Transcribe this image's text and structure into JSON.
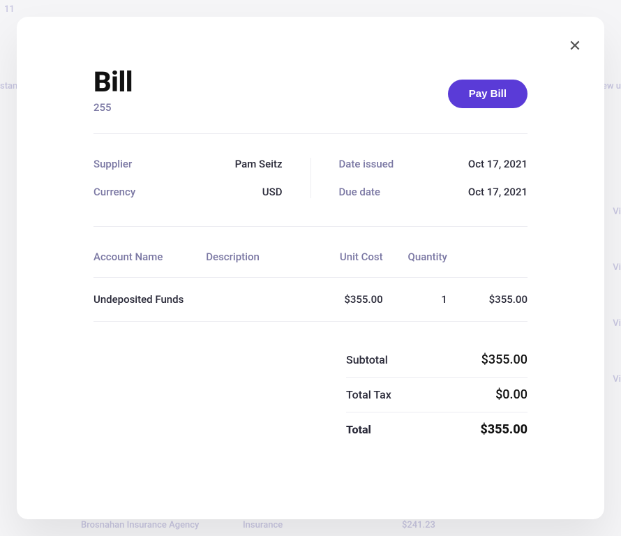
{
  "background": {
    "far_left_top": "11",
    "left_trunc": "stan",
    "right_trunc": "ew u",
    "vi": "Vi",
    "bottom_agency": "Brosnahan Insurance Agency",
    "bottom_category": "Insurance",
    "bottom_amount": "$241.23"
  },
  "modal": {
    "title": "Bill",
    "bill_id": "255",
    "pay_button": "Pay Bill",
    "close_glyph": "✕",
    "meta": {
      "supplier_label": "Supplier",
      "supplier_value": "Pam Seitz",
      "currency_label": "Currency",
      "currency_value": "USD",
      "date_issued_label": "Date issued",
      "date_issued_value": "Oct 17, 2021",
      "due_date_label": "Due date",
      "due_date_value": "Oct 17, 2021"
    },
    "line_items": {
      "headers": {
        "account": "Account Name",
        "description": "Description",
        "unit_cost": "Unit Cost",
        "quantity": "Quantity",
        "total": ""
      },
      "rows": [
        {
          "account": "Undeposited Funds",
          "description": "",
          "unit_cost": "$355.00",
          "quantity": "1",
          "total": "$355.00"
        }
      ]
    },
    "totals": {
      "subtotal_label": "Subtotal",
      "subtotal_value": "$355.00",
      "tax_label": "Total Tax",
      "tax_value": "$0.00",
      "grand_label": "Total",
      "grand_value": "$355.00"
    }
  }
}
